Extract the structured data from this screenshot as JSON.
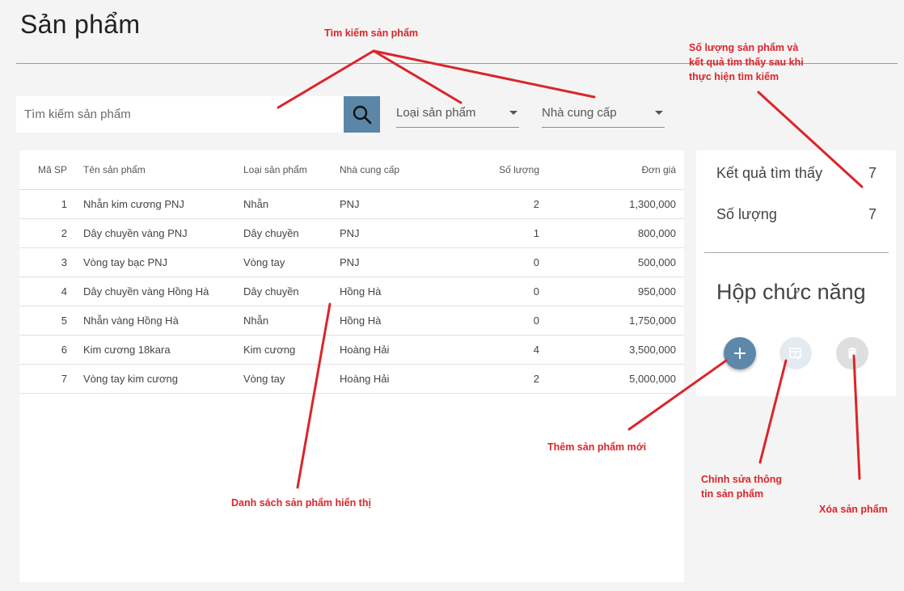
{
  "header": {
    "title": "Sản phẩm"
  },
  "search": {
    "placeholder": "Tìm kiếm sản phẩm"
  },
  "filters": {
    "category_label": "Loại sản phẩm",
    "supplier_label": "Nhà cung cấp"
  },
  "table": {
    "columns": [
      "Mã SP",
      "Tên sản phẩm",
      "Loại sản phẩm",
      "Nhà cung cấp",
      "Số lượng",
      "Đơn giá"
    ],
    "rows": [
      [
        "1",
        "Nhẫn kim cương PNJ",
        "Nhẫn",
        "PNJ",
        "2",
        "1,300,000"
      ],
      [
        "2",
        "Dây chuyền vàng PNJ",
        "Dây chuyền",
        "PNJ",
        "1",
        "800,000"
      ],
      [
        "3",
        "Vòng tay bạc PNJ",
        "Vòng tay",
        "PNJ",
        "0",
        "500,000"
      ],
      [
        "4",
        "Dây chuyền vàng Hồng Hà",
        "Dây chuyền",
        "Hồng Hà",
        "0",
        "950,000"
      ],
      [
        "5",
        "Nhẫn vàng Hồng Hà",
        "Nhẫn",
        "Hồng Hà",
        "0",
        "1,750,000"
      ],
      [
        "6",
        "Kim cương 18kara",
        "Kim cương",
        "Hoàng Hải",
        "4",
        "3,500,000"
      ],
      [
        "7",
        "Vòng tay kim cương",
        "Vòng tay",
        "Hoàng Hải",
        "2",
        "5,000,000"
      ]
    ]
  },
  "summary": {
    "results_label": "Kết quả tìm thấy",
    "results_value": "7",
    "quantity_label": "Số lượng",
    "quantity_value": "7"
  },
  "function_box": {
    "title": "Hộp chức năng",
    "buttons": {
      "add": "plus-icon",
      "edit": "table-edit-icon",
      "delete": "trash-icon"
    }
  },
  "annotations": {
    "search": "Tìm kiếm sản phẩm",
    "summary_line1": "Số lượng sản phẩm và",
    "summary_line2": "kết quả tìm thấy sau khi",
    "summary_line3": "thực hiện tìm kiếm",
    "list": "Danh sách sản phẩm hiển thị",
    "add": "Thêm sản phẩm mới",
    "edit_line1": "Chỉnh sửa thông",
    "edit_line2": "tin sản phẩm",
    "delete": "Xóa sản phẩm"
  },
  "colors": {
    "accent": "#5b86a7",
    "annotation": "#d9262b",
    "background": "#f4f4f4"
  }
}
